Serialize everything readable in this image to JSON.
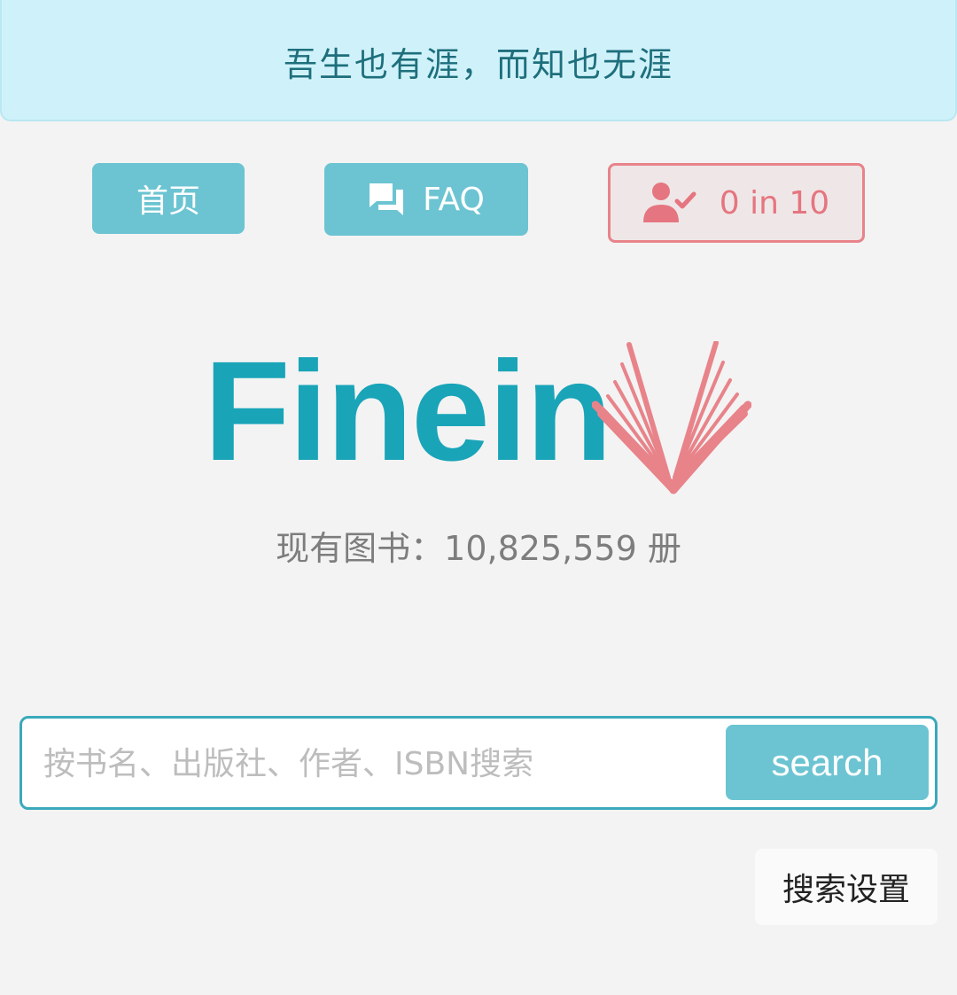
{
  "banner": {
    "text": "吾生也有涯，而知也无涯"
  },
  "nav": {
    "home_label": "首页",
    "faq_label": "FAQ",
    "quota_label": "0 in 10",
    "faq_icon": "chat-bubbles-icon",
    "quota_icon": "user-check-icon"
  },
  "logo": {
    "text": "Finein",
    "icon": "open-book-icon"
  },
  "stats": {
    "book_count": "现有图书：10,825,559 册"
  },
  "search": {
    "placeholder": "按书名、出版社、作者、ISBN搜索",
    "value": "",
    "button_label": "search"
  },
  "settings": {
    "label": "搜索设置"
  },
  "colors": {
    "accent": "#6cc4d2",
    "brand": "#19a4b8",
    "logo_book": "#e8838a",
    "banner_bg": "#cff2fa"
  }
}
